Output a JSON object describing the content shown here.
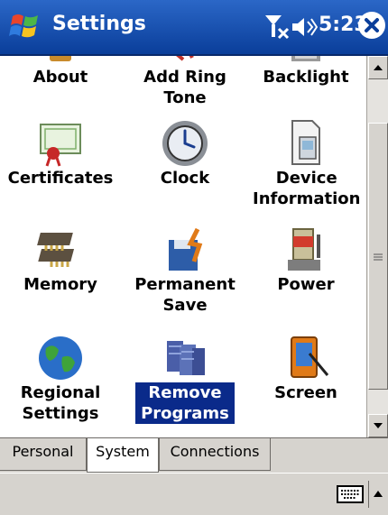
{
  "title_bar": {
    "title": "Settings",
    "time": "5:23",
    "icons": [
      "windows-start-icon",
      "no-signal-icon",
      "volume-icon",
      "close-icon"
    ]
  },
  "items": [
    {
      "label": "About",
      "icon": "about-icon"
    },
    {
      "label": "Add Ring Tone",
      "icon": "ring-tone-icon"
    },
    {
      "label": "Backlight",
      "icon": "backlight-icon"
    },
    {
      "label": "Certificates",
      "icon": "certificate-icon"
    },
    {
      "label": "Clock",
      "icon": "clock-icon"
    },
    {
      "label": "Device Information",
      "icon": "device-info-icon"
    },
    {
      "label": "Memory",
      "icon": "memory-icon"
    },
    {
      "label": "Permanent Save",
      "icon": "permanent-save-icon"
    },
    {
      "label": "Power",
      "icon": "power-icon"
    },
    {
      "label": "Regional Settings",
      "icon": "globe-icon"
    },
    {
      "label": "Remove Programs",
      "icon": "remove-programs-icon",
      "selected": true
    },
    {
      "label": "Screen",
      "icon": "screen-icon"
    }
  ],
  "tabs": [
    {
      "label": "Personal"
    },
    {
      "label": "System",
      "active": true
    },
    {
      "label": "Connections"
    }
  ],
  "colors": {
    "titlebar": "#0a3e9a",
    "selection": "#0a2a8a",
    "chrome": "#d6d3ce"
  }
}
